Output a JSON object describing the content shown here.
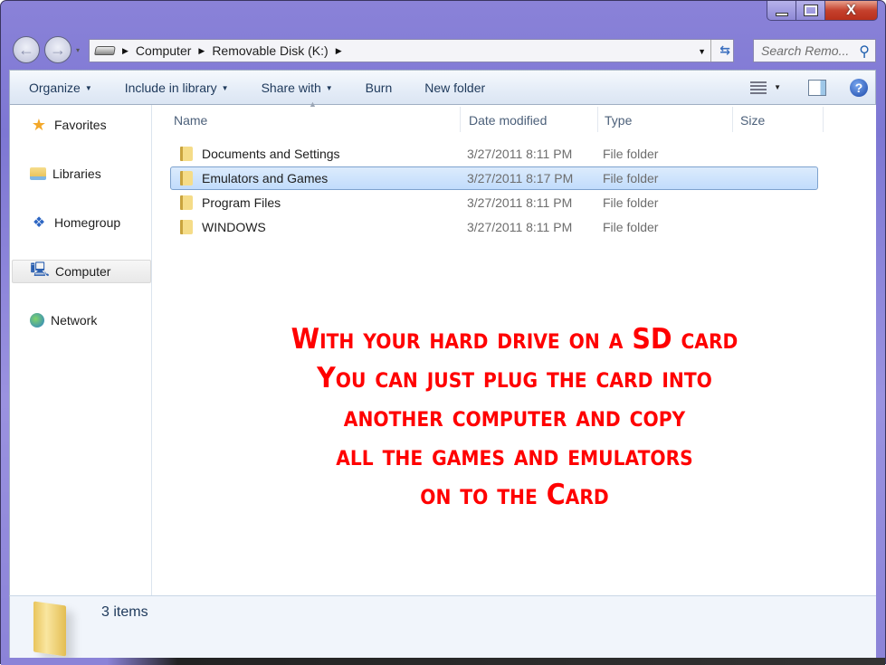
{
  "window": {
    "caption_buttons": [
      {
        "name": "minimize",
        "glyph": "_"
      },
      {
        "name": "maximize",
        "glyph": "□"
      },
      {
        "name": "close",
        "glyph": "X"
      }
    ]
  },
  "navigation": {
    "back_glyph": "←",
    "forward_glyph": "→",
    "recent_glyph": "▾"
  },
  "address": {
    "icon": "removable-drive-icon",
    "crumbs": [
      "Computer",
      "Removable Disk (K:)"
    ],
    "separator_glyph": "▶",
    "dropdown_glyph": "▼",
    "refresh_glyph": "⇆"
  },
  "search": {
    "placeholder": "Search Remo...",
    "icon_glyph": "⚲"
  },
  "toolbar": {
    "items": [
      {
        "label": "Organize",
        "has_dropdown": true
      },
      {
        "label": "Include in library",
        "has_dropdown": true
      },
      {
        "label": "Share with",
        "has_dropdown": true
      },
      {
        "label": "Burn",
        "has_dropdown": false
      },
      {
        "label": "New folder",
        "has_dropdown": false
      }
    ],
    "caret": "▼",
    "views_caret": "▼",
    "help_glyph": "?"
  },
  "sidebar": {
    "items": [
      {
        "label": "Favorites",
        "icon": "star-icon",
        "glyph": "★",
        "selected": false
      },
      {
        "label": "Libraries",
        "icon": "libraries-icon",
        "glyph": "",
        "selected": false
      },
      {
        "label": "Homegroup",
        "icon": "homegroup-icon",
        "glyph": "❖",
        "selected": false
      },
      {
        "label": "Computer",
        "icon": "computer-icon",
        "glyph": "🖳",
        "selected": true
      },
      {
        "label": "Network",
        "icon": "network-icon",
        "glyph": "",
        "selected": false
      }
    ]
  },
  "file_list": {
    "columns": [
      "Name",
      "Date modified",
      "Type",
      "Size"
    ],
    "sort_glyph": "▲",
    "rows": [
      {
        "name": "Documents and Settings",
        "date": "3/27/2011 8:11 PM",
        "type": "File folder",
        "size": "",
        "selected": false
      },
      {
        "name": "Emulators and Games",
        "date": "3/27/2011 8:17 PM",
        "type": "File folder",
        "size": "",
        "selected": true
      },
      {
        "name": "Program Files",
        "date": "3/27/2011 8:11 PM",
        "type": "File folder",
        "size": "",
        "selected": false
      },
      {
        "name": "WINDOWS",
        "date": "3/27/2011 8:11 PM",
        "type": "File folder",
        "size": "",
        "selected": false
      }
    ]
  },
  "overlay_text": {
    "color": "#ff0000",
    "lines": [
      "With your hard drive on a SD card",
      "You can just plug the card into",
      "another computer and copy",
      "all the games and emulators",
      "on to the Card"
    ]
  },
  "details_pane": {
    "item_count": "3 items"
  }
}
